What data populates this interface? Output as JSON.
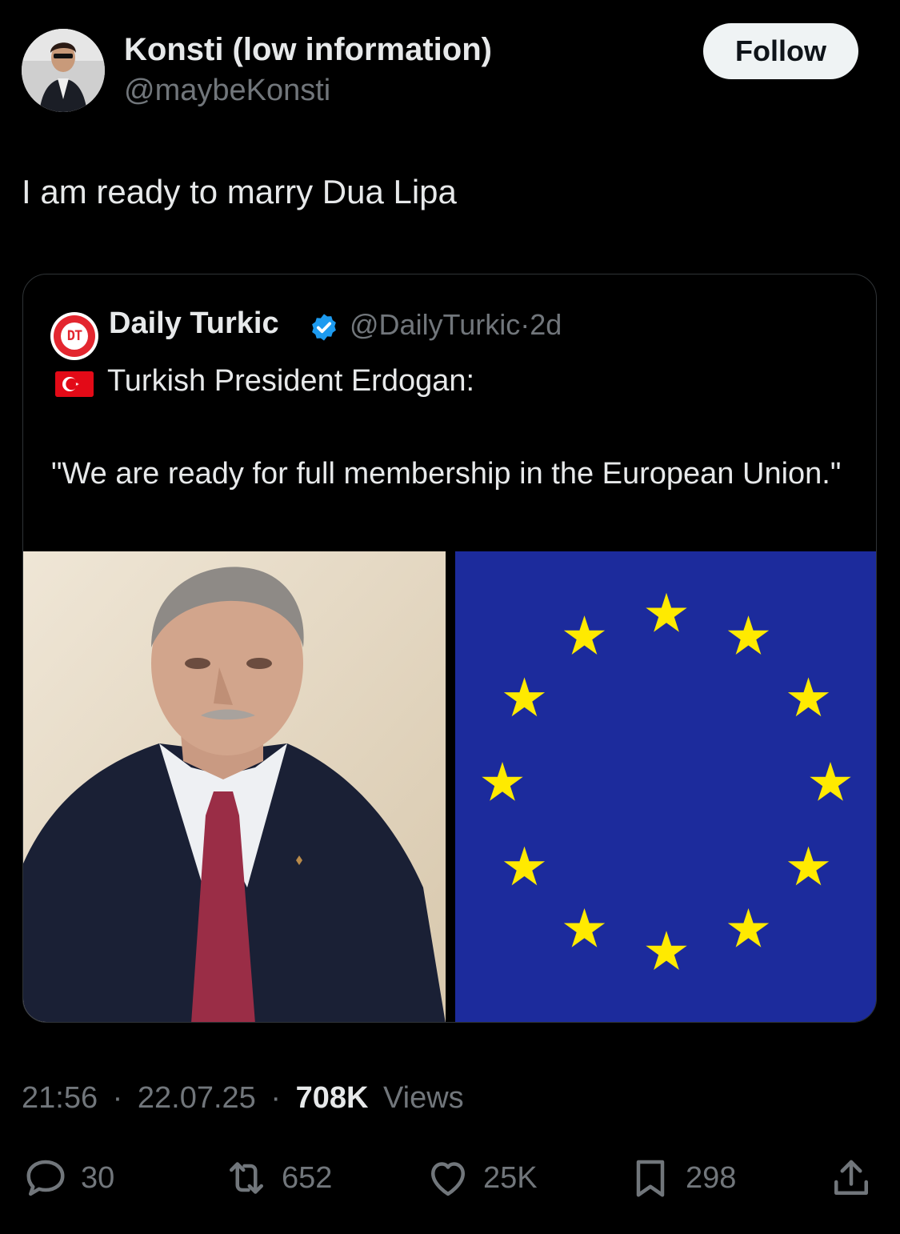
{
  "author": {
    "display_name": "Konsti (low information)",
    "handle": "@maybeKonsti"
  },
  "follow_button": {
    "label": "Follow"
  },
  "tweet": {
    "text": "I am ready to marry Dua Lipa"
  },
  "quoted": {
    "logo_text": "DT",
    "display_name": "Daily Turkic",
    "handle": "@DailyTurkic",
    "separator": "·",
    "time": "2d",
    "line1": "Turkish President Erdogan:",
    "quote": "\"We are ready for full membership in the European Union.\""
  },
  "meta": {
    "time": "21:56",
    "date": "22.07.25",
    "views_count": "708K",
    "views_label": "Views",
    "sep": "·"
  },
  "actions": {
    "replies": "30",
    "reposts": "652",
    "likes": "25K",
    "bookmarks": "298"
  },
  "colors": {
    "background": "#000000",
    "text": "#e7e9ea",
    "muted": "#71767b",
    "verified": "#1d9bf0",
    "eu_blue": "#1c2b9c",
    "eu_star": "#ffea00",
    "turkey_red": "#e30a17",
    "logo_red": "#e3262f"
  },
  "icons": {
    "reply": "speech-bubble-icon",
    "repost": "repost-arrows-icon",
    "like": "heart-icon",
    "bookmark": "bookmark-icon",
    "share": "upload-share-icon",
    "verified": "verified-badge-icon"
  }
}
